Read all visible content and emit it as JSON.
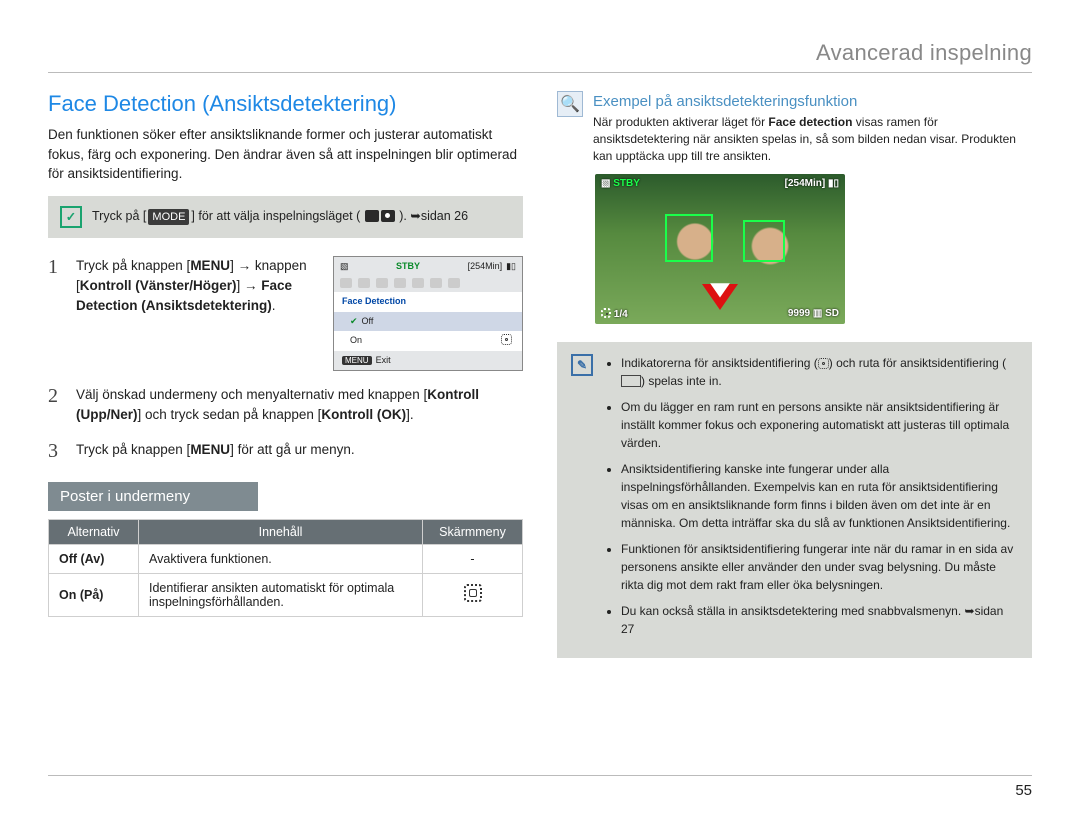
{
  "header": {
    "chapter": "Avancerad inspelning"
  },
  "left": {
    "title": "Face Detection (Ansiktsdetektering)",
    "intro_parts": [
      "Den funktionen söker efter ansiktsliknande former och justerar automatiskt fokus, färg och exponering. Den ändrar även så att inspelningen blir optimerad för ansiktsidentifiering."
    ],
    "tip": {
      "pre": "Tryck på [",
      "mode": "MODE",
      "post": "] för att välja inspelningsläget (",
      "after_icons": "). ➥sidan 26"
    },
    "steps": [
      {
        "num": "1",
        "parts": {
          "a": "Tryck på knappen [",
          "b": "MENU",
          "c": "] → knappen [",
          "d": "Kontroll (Vänster/Höger)",
          "e": "] → ",
          "f": "Face Detection (Ansiktsdetektering)",
          "g": "."
        }
      },
      {
        "num": "2",
        "parts": {
          "a": "Välj önskad undermeny och menyalternativ med knappen [",
          "b": "Kontroll (Upp/Ner)",
          "c": "] och tryck sedan på knappen [",
          "d": "Kontroll (OK)",
          "e": "]."
        }
      },
      {
        "num": "3",
        "parts": {
          "a": "Tryck på knappen [",
          "b": "MENU",
          "c": "] för att gå ur menyn."
        }
      }
    ],
    "lcd": {
      "stby": "STBY",
      "time": "[254Min]",
      "menu_title": "Face Detection",
      "off": "Off",
      "on": "On",
      "exit_chip": "MENU",
      "exit": "Exit"
    },
    "submenu_banner": "Poster i undermeny",
    "table": {
      "headers": {
        "opt": "Alternativ",
        "content": "Innehåll",
        "screen": "Skärmmeny"
      },
      "rows": [
        {
          "opt": "Off (Av)",
          "content": "Avaktivera funktionen.",
          "screen": "-"
        },
        {
          "opt": "On (På)",
          "content": "Identifierar ansikten automatiskt för optimala inspelningsförhållanden.",
          "screen": "icon"
        }
      ]
    }
  },
  "right": {
    "example_title": "Exempel på ansiktsdetekteringsfunktion",
    "example_desc_parts": {
      "a": "När produkten aktiverar läget för ",
      "b": "Face detection",
      "c": " visas ramen för ansiktsdetektering när ansikten spelas in, så som bilden nedan visar. Produkten kan upptäcka upp till tre ansikten."
    },
    "photo_osd": {
      "stby": "STBY",
      "time": "[254Min]",
      "count": "9999",
      "sd": "SD",
      "ratio": "1/4"
    },
    "notes": [
      {
        "a": "Indikatorerna för ansiktsidentifiering (",
        "b": ") och ruta för ansiktsidentifiering (",
        "c": ") spelas inte in."
      },
      {
        "text": "Om du lägger en ram runt en persons ansikte när ansiktsidentifiering är inställt kommer fokus och exponering automatiskt att justeras till optimala värden."
      },
      {
        "text": "Ansiktsidentifiering kanske inte fungerar under alla inspelningsförhållanden. Exempelvis kan en ruta för ansiktsidentifiering visas om en ansiktsliknande form finns i bilden även om det inte är en människa. Om detta inträffar ska du slå av funktionen Ansiktsidentifiering."
      },
      {
        "text": "Funktionen för ansiktsidentifiering fungerar inte när du ramar in en sida av personens ansikte eller använder den under svag belysning. Du måste rikta dig mot dem rakt fram eller öka belysningen."
      },
      {
        "a": "Du kan också ställa in ansiktsdetektering med snabbvalsmenyn. ➥sidan 27"
      }
    ]
  },
  "page_number": "55"
}
